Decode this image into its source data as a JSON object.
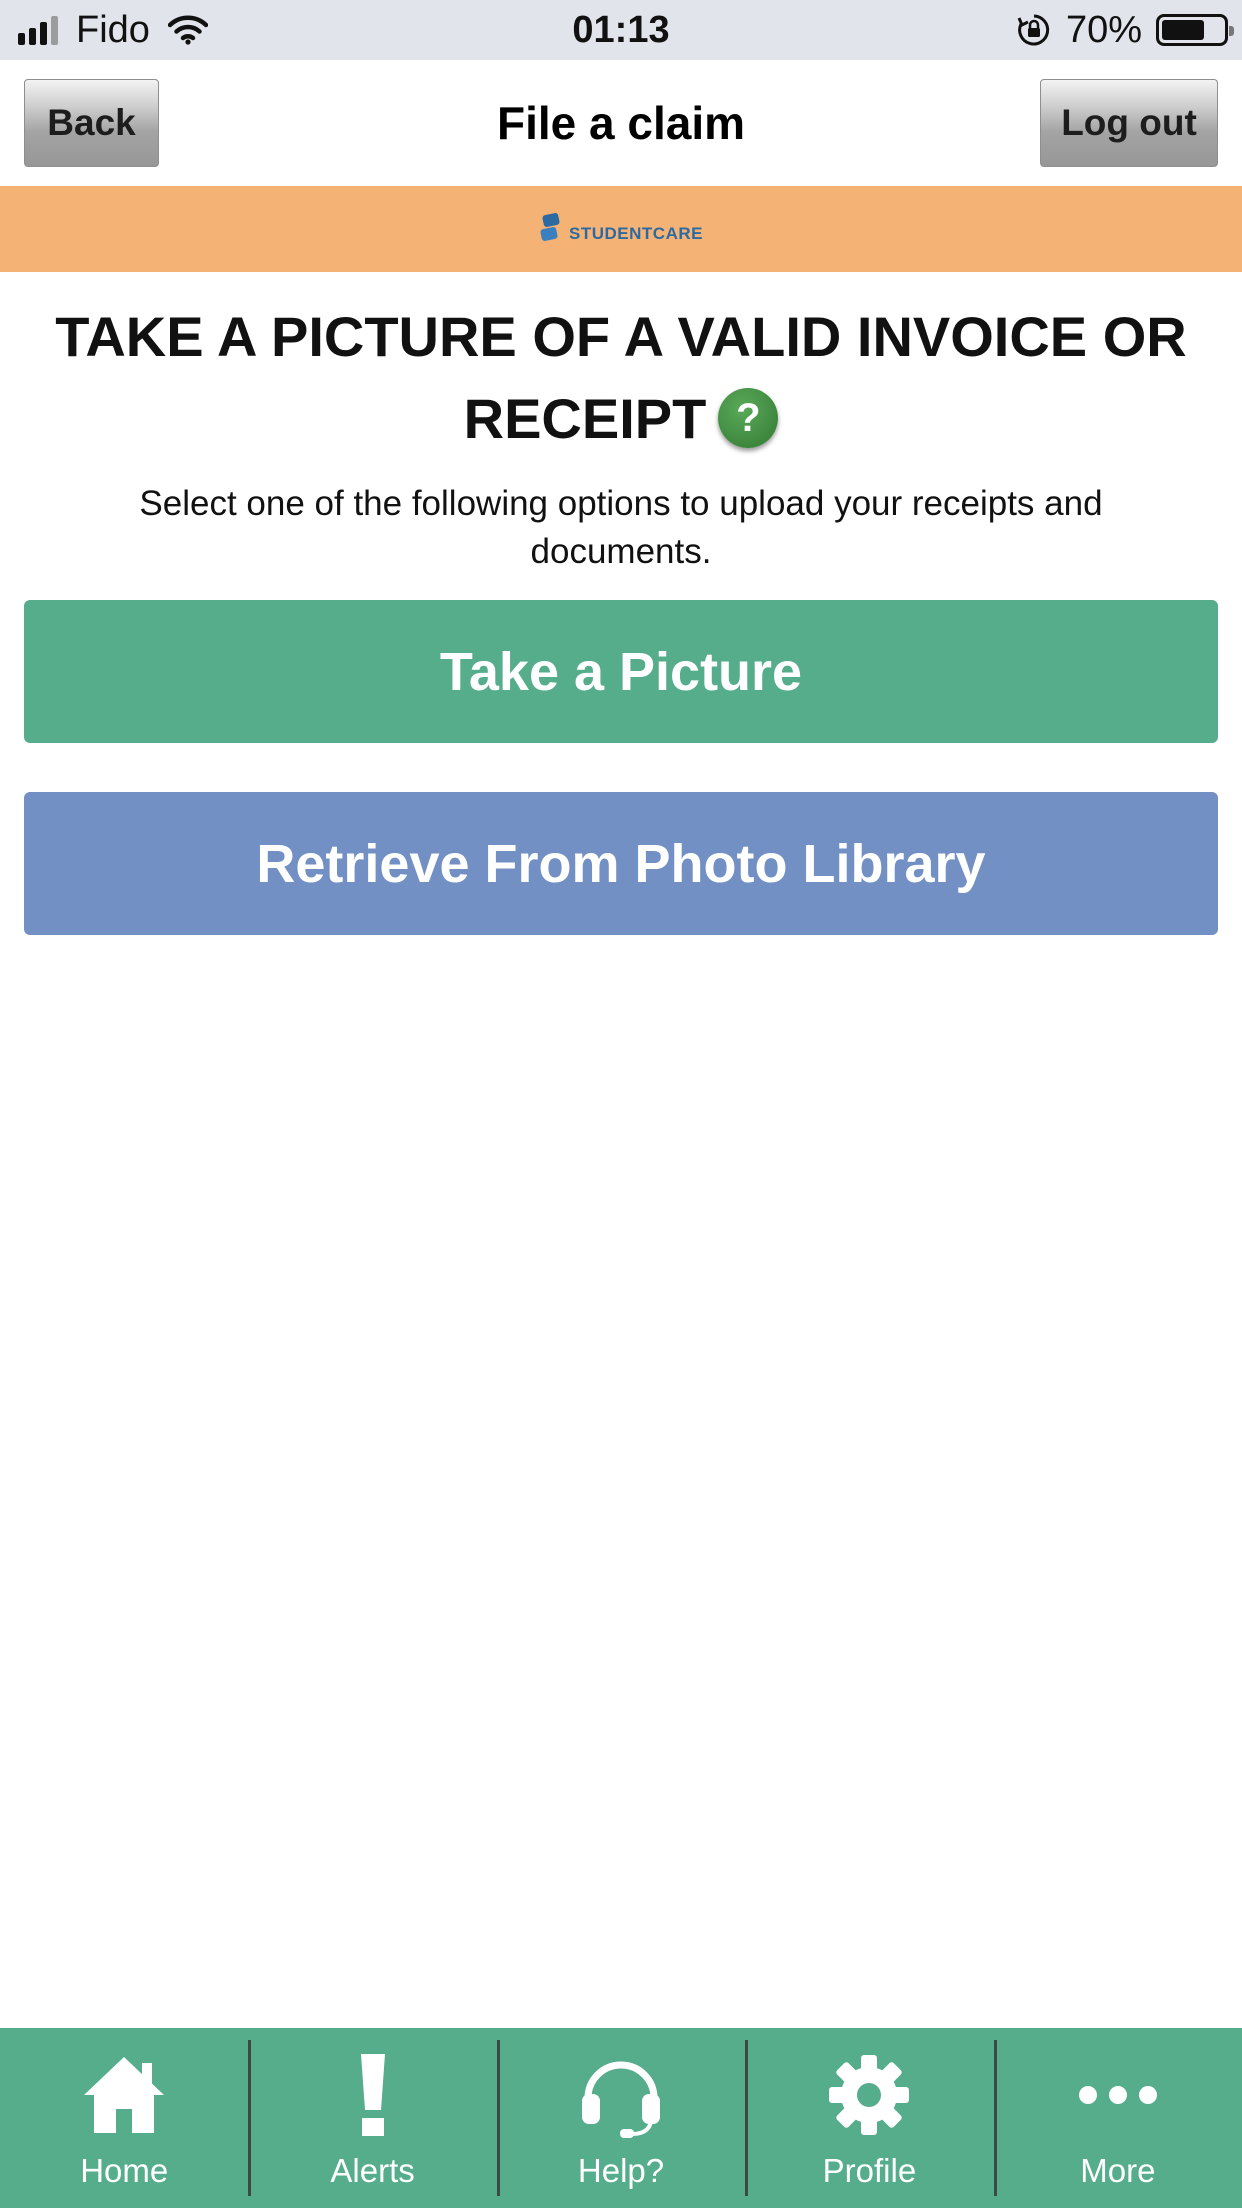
{
  "status_bar": {
    "carrier": "Fido",
    "time": "01:13",
    "battery_percent": "70%",
    "battery_level": 0.7,
    "signal_bars": 4,
    "signal_bars_filled": 3
  },
  "nav": {
    "back_label": "Back",
    "title": "File a claim",
    "logout_label": "Log out"
  },
  "brand": {
    "logo_text": "STUDENTCARE",
    "banner_color": "#f4b275"
  },
  "content": {
    "heading": "TAKE A PICTURE OF A VALID INVOICE OR RECEIPT",
    "help_icon_glyph": "?",
    "subtext": "Select one of the following options to upload your receipts and documents.",
    "take_picture_label": "Take a Picture",
    "retrieve_library_label": "Retrieve From Photo Library"
  },
  "tab_bar": {
    "items": [
      {
        "label": "Home",
        "icon": "home-icon"
      },
      {
        "label": "Alerts",
        "icon": "exclamation-icon"
      },
      {
        "label": "Help?",
        "icon": "headset-icon"
      },
      {
        "label": "Profile",
        "icon": "gear-icon"
      },
      {
        "label": "More",
        "icon": "more-dots-icon"
      }
    ]
  },
  "colors": {
    "primary_green": "#55ad8b",
    "library_blue": "#7290c4",
    "help_green": "#3f8f3f"
  }
}
